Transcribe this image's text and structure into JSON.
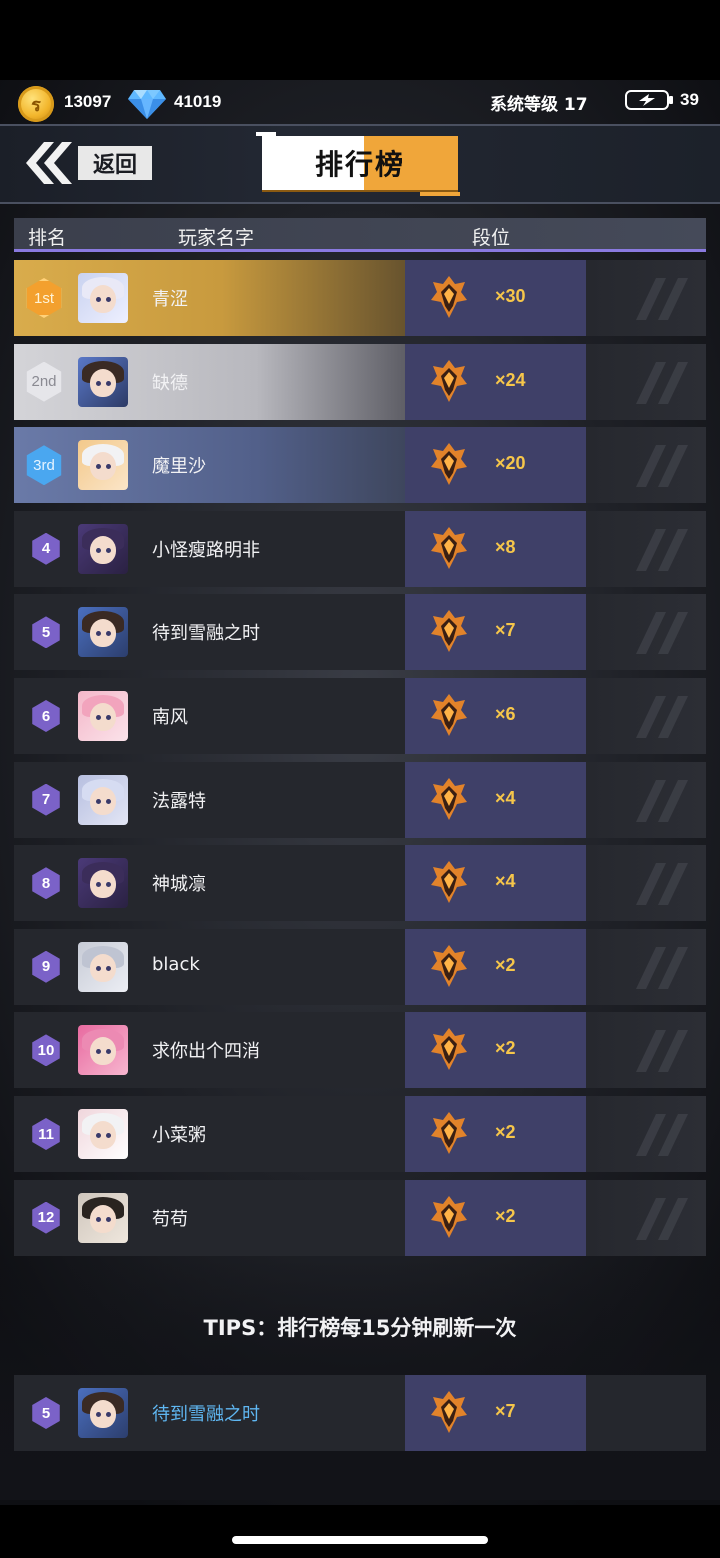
{
  "status": {
    "coins": "13097",
    "gems": "41019",
    "system_level": "系统等级 17",
    "energy": "39"
  },
  "header": {
    "back_label": "返回",
    "title": "排行榜"
  },
  "columns": {
    "rank": "排名",
    "player_name": "玩家名字",
    "tier": "段位"
  },
  "ranking": [
    {
      "rank": "1st",
      "name": "青涩",
      "count": "×30"
    },
    {
      "rank": "2nd",
      "name": "缺德",
      "count": "×24"
    },
    {
      "rank": "3rd",
      "name": "魔里沙",
      "count": "×20"
    },
    {
      "rank": "4",
      "name": "小怪瘦路明非",
      "count": "×8"
    },
    {
      "rank": "5",
      "name": "待到雪融之时",
      "count": "×7"
    },
    {
      "rank": "6",
      "name": "南风",
      "count": "×6"
    },
    {
      "rank": "7",
      "name": "法露特",
      "count": "×4"
    },
    {
      "rank": "8",
      "name": "神城凛",
      "count": "×4"
    },
    {
      "rank": "9",
      "name": "black",
      "count": "×2"
    },
    {
      "rank": "10",
      "name": "求你出个四消",
      "count": "×2"
    },
    {
      "rank": "11",
      "name": "小菜粥",
      "count": "×2"
    },
    {
      "rank": "12",
      "name": "苟苟",
      "count": "×2"
    }
  ],
  "tips": "TIPS：排行榜每15分钟刷新一次",
  "self": {
    "rank": "5",
    "name": "待到雪融之时",
    "count": "×7"
  },
  "colors": {
    "accent_gold": "#f6c64a",
    "tier_cell": "#3f4068",
    "rank_hex": "#7b62c8",
    "self_name": "#5fb7f2"
  }
}
